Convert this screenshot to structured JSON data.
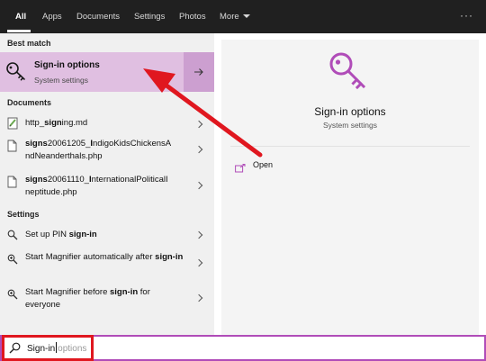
{
  "tabs": [
    {
      "label": "All",
      "active": true
    },
    {
      "label": "Apps"
    },
    {
      "label": "Documents"
    },
    {
      "label": "Settings"
    },
    {
      "label": "Photos"
    },
    {
      "label": "More"
    }
  ],
  "overflow_label": "···",
  "best_match": {
    "section_label": "Best match",
    "title": "Sign-in options",
    "subtitle": "System settings",
    "icon": "key-icon"
  },
  "documents": {
    "section_label": "Documents",
    "items": [
      {
        "text": "http_signing.md",
        "bold": "signing",
        "icon": "markdown-file-icon"
      },
      {
        "text": "signs20061205_IndigoKidsChickensAndNeanderthals.php",
        "icon": "file-icon"
      },
      {
        "text": "signs20061110_InternationalPoliticalIneptitude.php",
        "icon": "file-icon"
      }
    ]
  },
  "settings": {
    "section_label": "Settings",
    "items": [
      {
        "text": "Set up PIN sign-in",
        "icon": "search-settings-icon"
      },
      {
        "text": "Start Magnifier automatically after sign-in",
        "icon": "magnifier-icon"
      },
      {
        "text": "Start Magnifier before sign-in for everyone",
        "icon": "magnifier-icon"
      }
    ]
  },
  "preview": {
    "title": "Sign-in options",
    "subtitle": "System settings",
    "icon": "key-icon",
    "action_label": "Open",
    "action_icon": "open-icon"
  },
  "search": {
    "typed": "Sign-in",
    "suggestion": "options",
    "icon": "search-icon"
  },
  "colors": {
    "accent": "#b04cb8",
    "highlight": "#e0bfe1",
    "highlight_dark": "#cc9fd0",
    "annotation": "#e0171f"
  }
}
